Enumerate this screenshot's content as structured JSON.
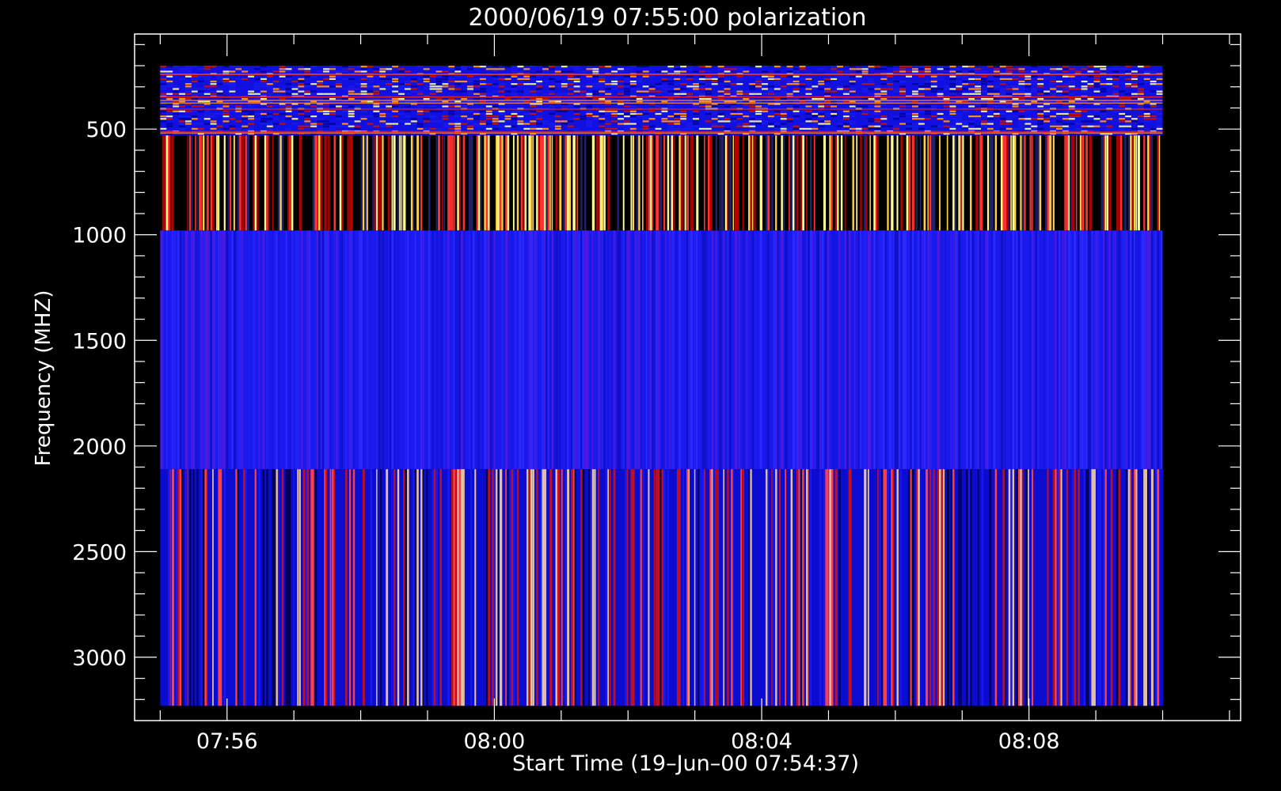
{
  "chart_data": {
    "type": "heatmap",
    "title": "2000/06/19 07:55:00 polarization",
    "xlabel": "Start Time (19–Jun–00 07:54:37)",
    "ylabel": "Frequency (MHZ)",
    "x_range": [
      "07:54:37",
      "08:11:10"
    ],
    "x_data_range": [
      "07:55:00",
      "08:10:00"
    ],
    "x_ticks": [
      "07:56",
      "08:00",
      "08:04",
      "08:08"
    ],
    "ylim": [
      3300,
      50
    ],
    "y_ticks": [
      500,
      1000,
      1500,
      2000,
      2500,
      3000
    ],
    "bands": [
      {
        "freq_from": 200,
        "freq_to": 530,
        "base": "#1010e0",
        "palette": [
          "#1a1ae8",
          "#c01010",
          "#ff8c20",
          "#e8e8a0",
          "#1a1ae8",
          "#0000a0"
        ],
        "pattern": "dense-noise"
      },
      {
        "freq_from": 530,
        "freq_to": 980,
        "base": "#000000",
        "palette": [
          "#000000",
          "#b00000",
          "#ff3030",
          "#ffd040",
          "#ffff90",
          "#202070"
        ],
        "pattern": "vertical-stripes"
      },
      {
        "freq_from": 980,
        "freq_to": 2110,
        "base": "#1a1aee",
        "palette": [
          "#1515e0",
          "#2222f5",
          "#1010c8",
          "#2a2aff",
          "#4a1ae0"
        ],
        "pattern": "vertical-stripes"
      },
      {
        "freq_from": 2110,
        "freq_to": 3230,
        "base": "#0c0cd0",
        "palette": [
          "#0c0cd0",
          "#1818f0",
          "#c01020",
          "#ff4040",
          "#e0c0a0",
          "#000050"
        ],
        "pattern": "vertical-stripes"
      }
    ]
  }
}
